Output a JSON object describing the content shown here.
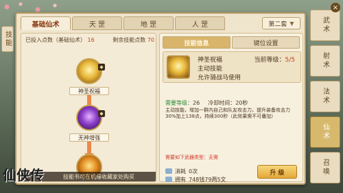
{
  "side_tab": "技能",
  "tabs": [
    "基础仙术",
    "天 罡",
    "地 罡",
    "人 罡"
  ],
  "set_select": "第二套",
  "points": {
    "label": "已投入点数（基础仙术）",
    "value": "16",
    "left_label": "剩余技能点数",
    "left_value": "70"
  },
  "skills": [
    {
      "name": "神圣祝福",
      "badge": "◆"
    },
    {
      "name": "无神增强",
      "badge": "◆"
    },
    {
      "name": "",
      "badge": ""
    }
  ],
  "bottom_tip": "技能书可在机缘收藏家处购买",
  "detail_tabs": [
    "技能信息",
    "键位设置"
  ],
  "skill_card": {
    "name": "神圣祝福",
    "level_label": "当前等级：",
    "level_value": "5/5",
    "type": "主动技能",
    "usage": "允许骑战马使用"
  },
  "stats": {
    "need_level_label": "需要等级：",
    "need_level": "26",
    "cooldown_label": "冷却时间：",
    "cooldown": "20秒"
  },
  "description": "主动技能，增加一群内自己和队友攻击力，提升装备攻击力30%加上138点，持续300秒（此效果需不可叠加）",
  "requirement": "需要如下武器类型：无需",
  "cost": {
    "row1_label": "消耗",
    "row1_value": "0次",
    "row2_label": "拥有",
    "row2_value": "748钱79两5文"
  },
  "upgrade_label": "升 级",
  "classes": [
    "武术",
    "射术",
    "法术",
    "仙术",
    "召唤"
  ],
  "active_class": "仙术",
  "logo_text": "仙侠传"
}
